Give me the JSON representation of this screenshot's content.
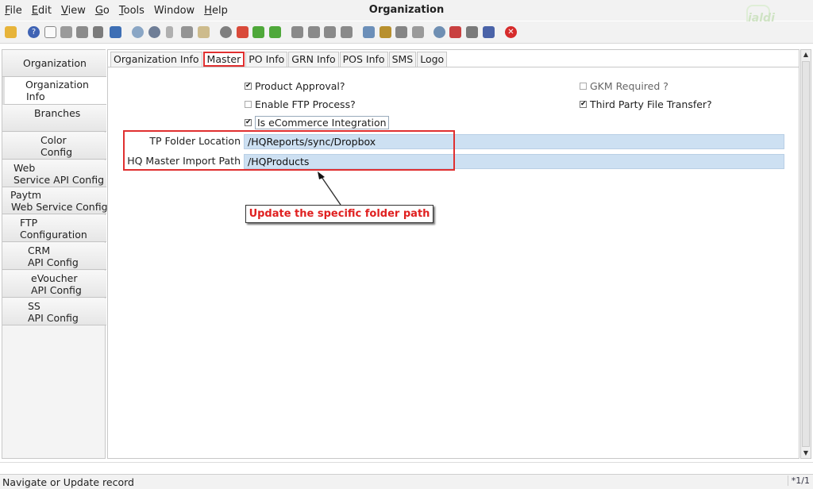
{
  "window": {
    "title": "Organization"
  },
  "menu": {
    "items": [
      {
        "first": "F",
        "rest": "ile"
      },
      {
        "first": "E",
        "rest": "dit"
      },
      {
        "first": "V",
        "rest": "iew"
      },
      {
        "first": "G",
        "rest": "o"
      },
      {
        "first": "T",
        "rest": "ools"
      },
      {
        "first": "",
        "rest": "Window"
      },
      {
        "first": "H",
        "rest": "elp"
      }
    ]
  },
  "toolbar": {
    "icons": [
      "undo-icon",
      "help-icon",
      "new-icon",
      "copy-icon",
      "delete-icon",
      "tools-icon",
      "save-icon",
      "refresh-icon",
      "find-icon",
      "attach-icon",
      "chat-icon",
      "history-icon",
      "home-icon",
      "back-icon",
      "forward-icon",
      "first-record-icon",
      "previous-record-icon",
      "next-record-icon",
      "last-record-icon",
      "report-icon",
      "archive-icon",
      "print-icon",
      "print-preview-icon",
      "zoom-icon",
      "workflow-icon",
      "request-icon",
      "product-icon",
      "exit-icon"
    ]
  },
  "sidebar": {
    "items": [
      {
        "line1": "Organization",
        "line2": ""
      },
      {
        "line1": "Organization",
        "line2": "Info"
      },
      {
        "line1": "Branches",
        "line2": ""
      },
      {
        "line1": "Color",
        "line2": "Config"
      },
      {
        "line1": "Web",
        "line2": "Service API Config"
      },
      {
        "line1": "Paytm",
        "line2": "Web Service Config"
      },
      {
        "line1": "FTP",
        "line2": "Configuration"
      },
      {
        "line1": "CRM",
        "line2": "API Config"
      },
      {
        "line1": "eVoucher",
        "line2": "API Config"
      },
      {
        "line1": "SS",
        "line2": "API Config"
      }
    ]
  },
  "tabs": [
    "Organization Info",
    "Master",
    "PO Info",
    "GRN Info",
    "POS Info",
    "SMS",
    "Logo"
  ],
  "form": {
    "product_approval": "Product Approval?",
    "gkm_required": "GKM Required ?",
    "enable_ftp": "Enable FTP Process?",
    "third_party": "Third Party File Transfer?",
    "ecommerce": "Is eCommerce Integration",
    "tp_folder_label": "TP Folder Location",
    "tp_folder_value": "/HQReports/sync/Dropbox",
    "hq_master_label": "HQ Master Import Path",
    "hq_master_value": "/HQProducts"
  },
  "callout": {
    "text": "Update the specific folder path"
  },
  "status": {
    "text": "Navigate or Update record",
    "record": "*1/1"
  },
  "logo": {
    "text": "jaldi"
  },
  "colors": {
    "highlight": "#e03030",
    "field_bg": "#cde0f2"
  }
}
